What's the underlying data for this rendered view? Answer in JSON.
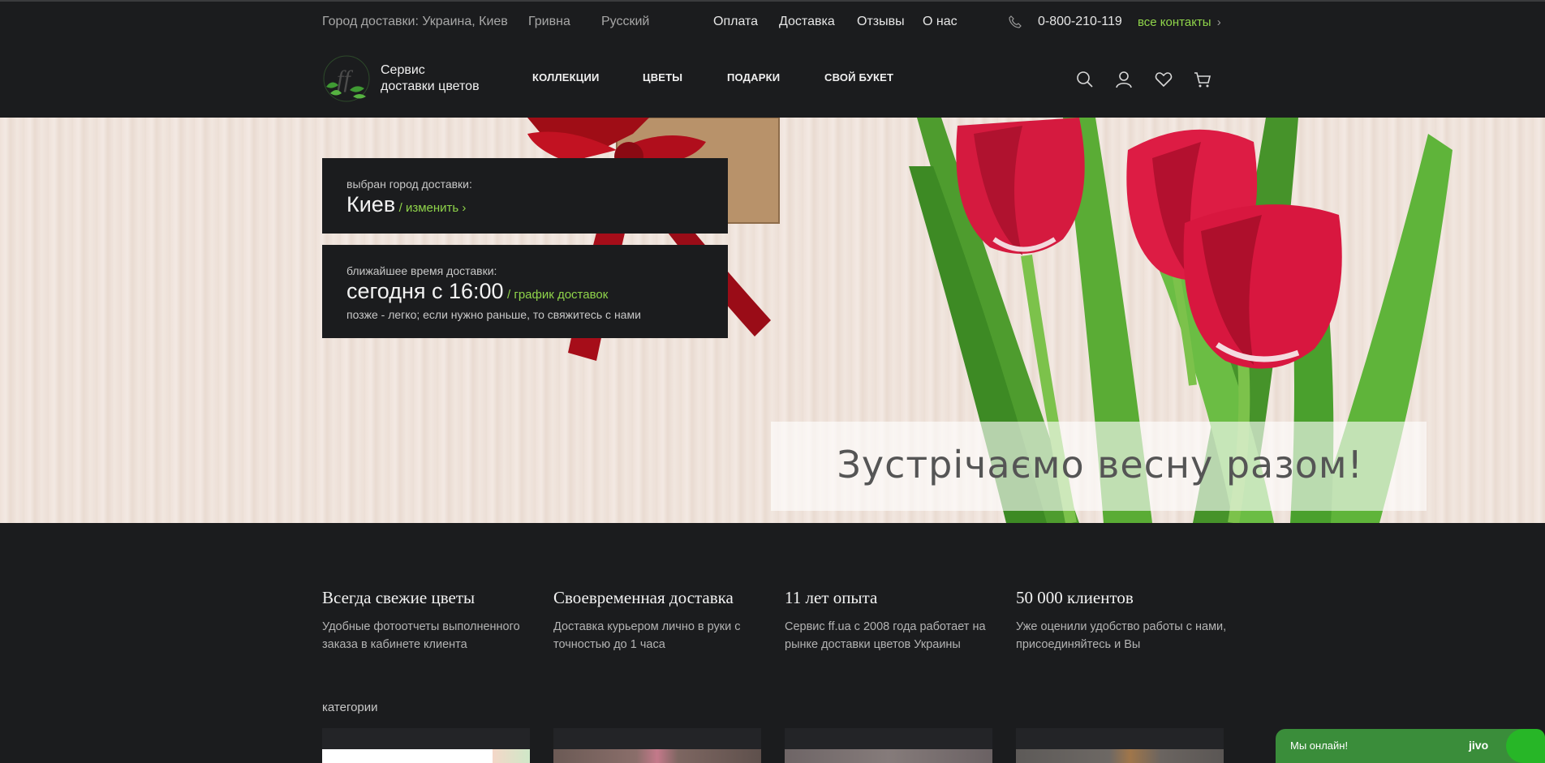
{
  "topbar": {
    "city": "Город доставки: Украина, Киев",
    "currency": "Гривна",
    "language": "Русский",
    "nav": [
      "Оплата",
      "Доставка",
      "Отзывы",
      "О нас"
    ],
    "phone": "0-800-210-119",
    "contacts": "все контакты",
    "contacts_arrow": "›"
  },
  "header": {
    "logo_line1": "Сервис",
    "logo_line2": "доставки цветов",
    "logo_letters": "ff",
    "nav": [
      "КОЛЛЕКЦИИ",
      "ЦВЕТЫ",
      "ПОДАРКИ",
      "СВОЙ БУКЕТ"
    ],
    "icons": [
      "search-icon",
      "user-icon",
      "heart-icon",
      "cart-icon"
    ]
  },
  "hero": {
    "city_label": "выбран город доставки:",
    "city": "Киев",
    "change_link": "/ изменить ›",
    "time_label": "ближайшее время доставки:",
    "time": "сегодня с 16:00",
    "schedule_link": "/ график доставок",
    "note": "позже - легко; если нужно раньше, то свяжитесь с нами",
    "banner": "Зустрічаємо весну разом!"
  },
  "features": [
    {
      "title": "Всегда свежие цветы",
      "text": "Удобные фотоотчеты выполненного заказа в кабинете клиента"
    },
    {
      "title": "Своевременная доставка",
      "text": "Доставка курьером лично в руки с точностью до 1 часа"
    },
    {
      "title": "11 лет опыта",
      "text": "Сервис ff.ua с 2008 года работает на рынке доставки цветов Украины"
    },
    {
      "title": "50 000 клиентов",
      "text": "Уже оценили удобство работы с нами, присоединяйтесь и Вы"
    }
  ],
  "categories_title": "категории",
  "chat": {
    "label": "Мы онлайн!",
    "brand": "jivo"
  },
  "colors": {
    "accent": "#8fd44a",
    "background": "#1b1c1e",
    "chat": "#3a8d3a"
  }
}
